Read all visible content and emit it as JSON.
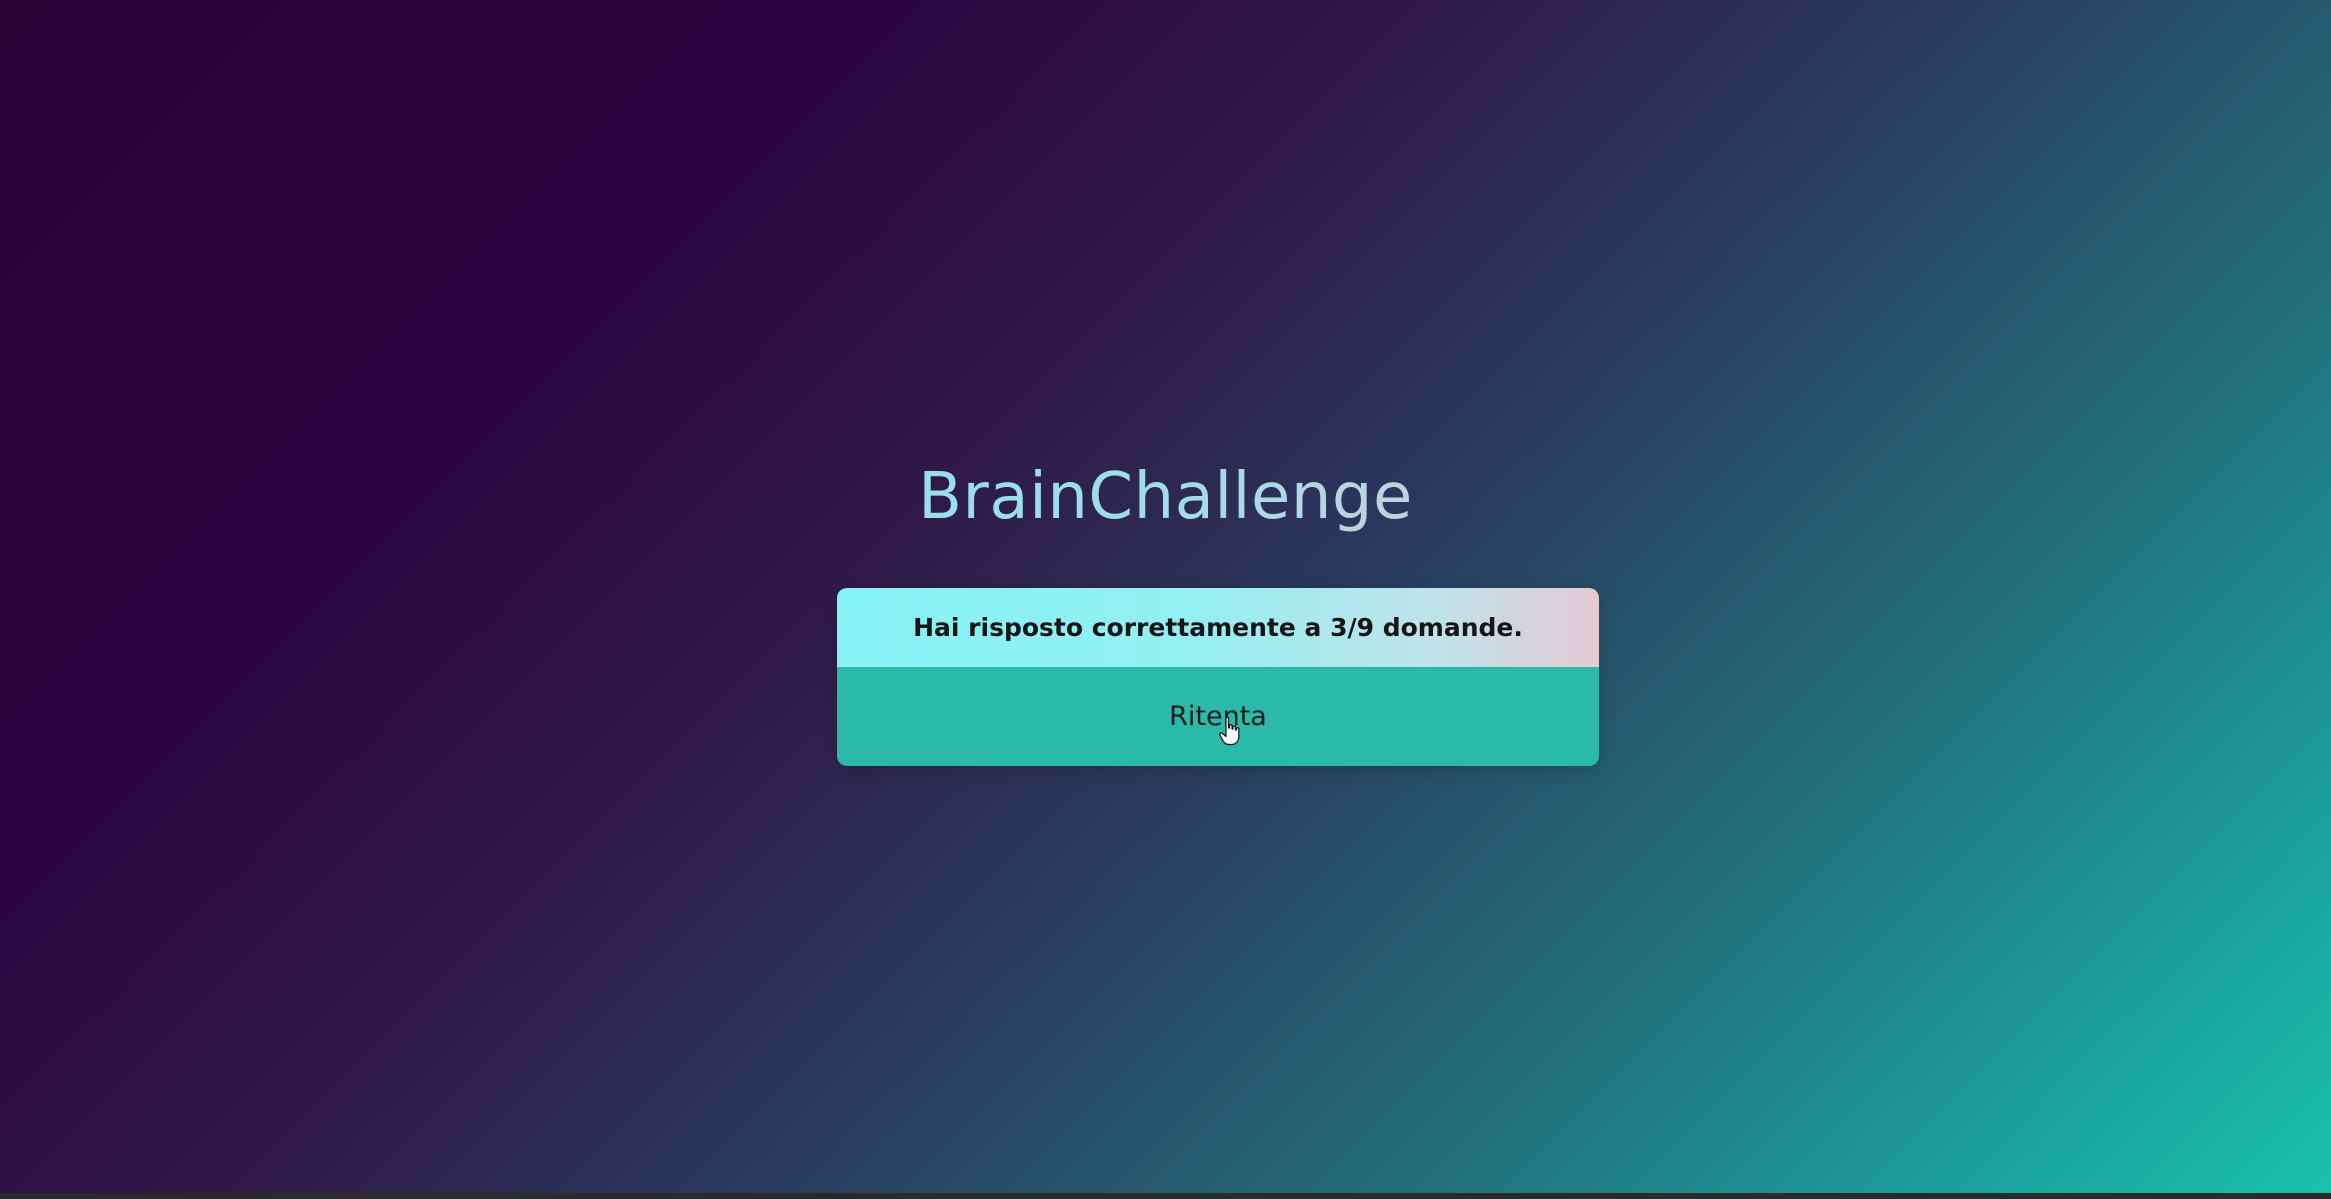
{
  "app": {
    "title": "BrainChallenge"
  },
  "result": {
    "message": "Hai risposto correttamente a 3/9 domande.",
    "retry_label": "Ritenta"
  },
  "icons": {
    "cursor": "hand-pointer-icon"
  },
  "colors": {
    "background_start": "#2b0236",
    "background_end": "#19c2ad",
    "title_gradient_start": "#7ee8f2",
    "title_gradient_end": "#e9c9d2",
    "message_bg": "#86f2f6",
    "retry_bg": "#2bbaaa"
  }
}
